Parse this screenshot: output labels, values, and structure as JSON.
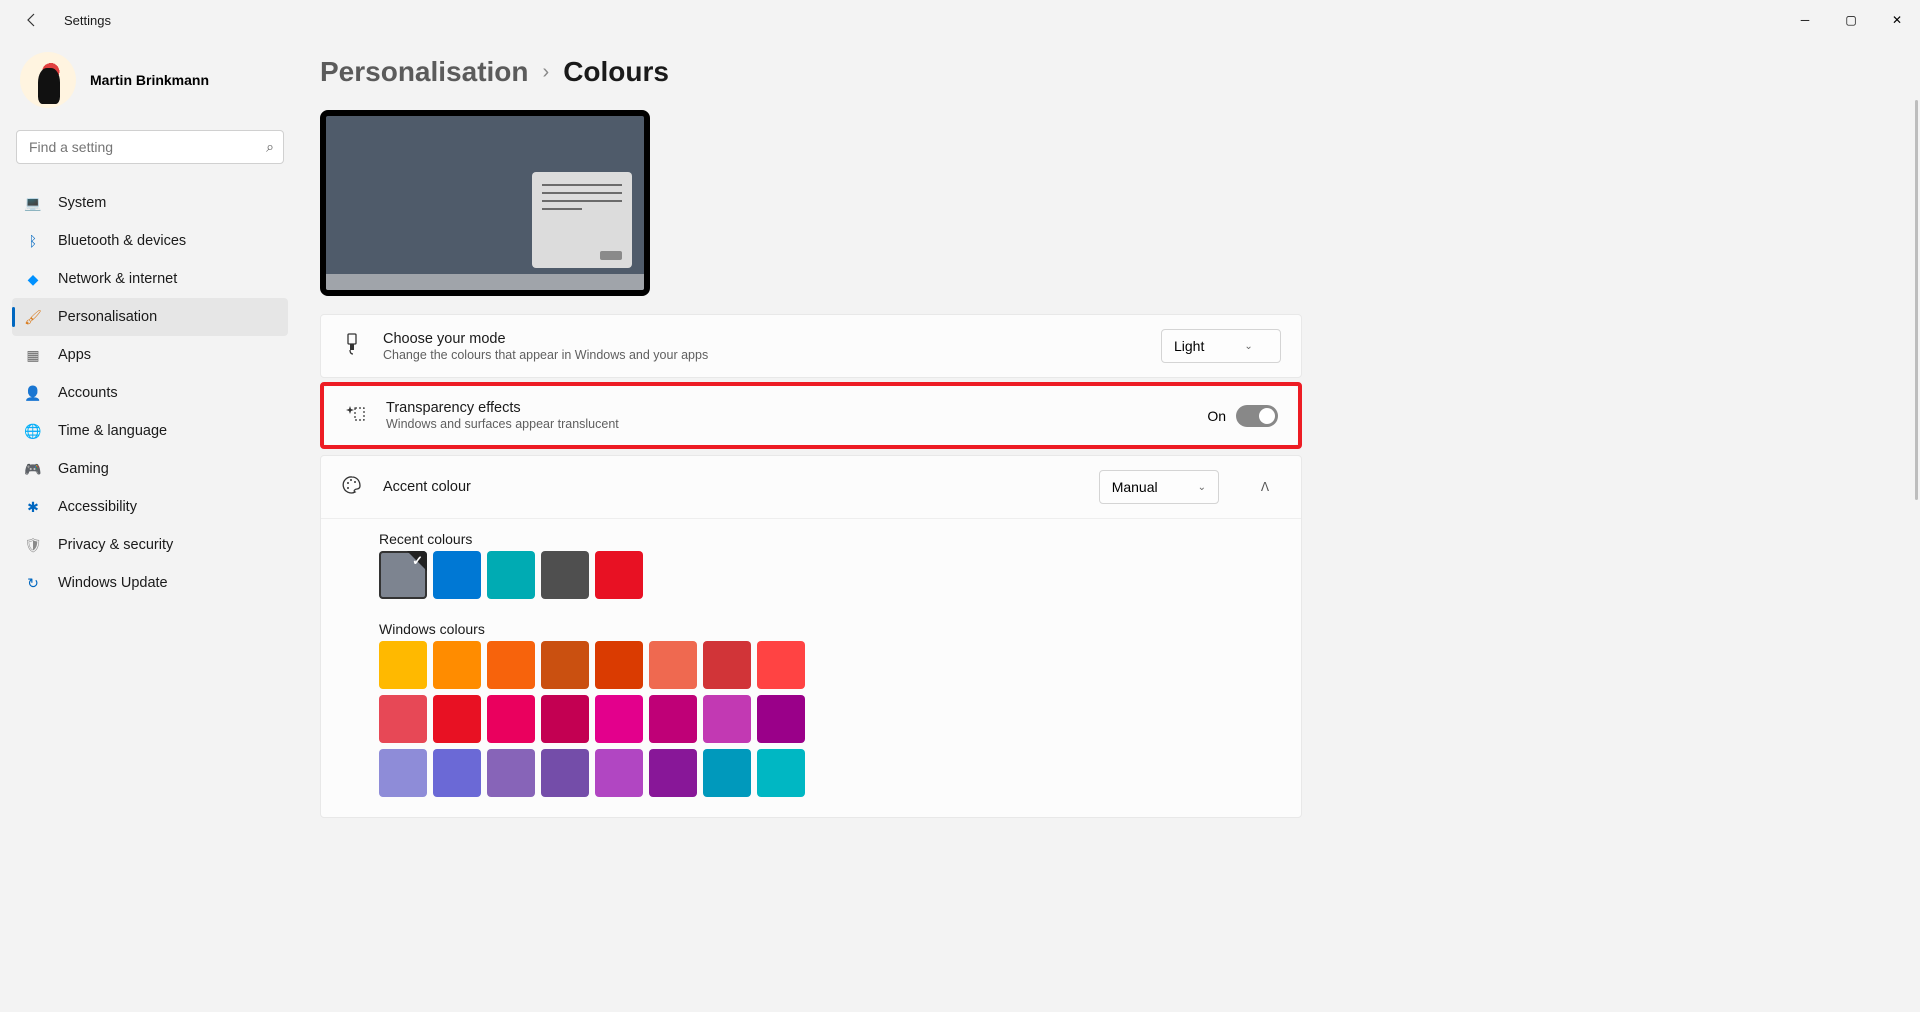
{
  "titlebar": {
    "title": "Settings"
  },
  "user": {
    "name": "Martin Brinkmann"
  },
  "search": {
    "placeholder": "Find a setting"
  },
  "nav": [
    {
      "label": "System",
      "icon": "💻",
      "color": "#0067c0"
    },
    {
      "label": "Bluetooth & devices",
      "icon": "ᛒ",
      "color": "#0067c0"
    },
    {
      "label": "Network & internet",
      "icon": "◆",
      "color": "#0091ff"
    },
    {
      "label": "Personalisation",
      "icon": "🖌",
      "color": "#d97a1b",
      "active": true
    },
    {
      "label": "Apps",
      "icon": "▦",
      "color": "#6a6a6a"
    },
    {
      "label": "Accounts",
      "icon": "👤",
      "color": "#0f8b4c"
    },
    {
      "label": "Time & language",
      "icon": "🌐",
      "color": "#5b7e9a"
    },
    {
      "label": "Gaming",
      "icon": "🎮",
      "color": "#8a8a8a"
    },
    {
      "label": "Accessibility",
      "icon": "✱",
      "color": "#0067c0"
    },
    {
      "label": "Privacy & security",
      "icon": "🛡",
      "color": "#8a8a8a"
    },
    {
      "label": "Windows Update",
      "icon": "↻",
      "color": "#0067c0"
    }
  ],
  "breadcrumb": {
    "parent": "Personalisation",
    "sep": "›",
    "current": "Colours"
  },
  "mode": {
    "title": "Choose your mode",
    "desc": "Change the colours that appear in Windows and your apps",
    "value": "Light"
  },
  "transparency": {
    "title": "Transparency effects",
    "desc": "Windows and surfaces appear translucent",
    "state_label": "On"
  },
  "accent": {
    "title": "Accent colour",
    "value": "Manual",
    "recent_label": "Recent colours",
    "recent": [
      "#7d8490",
      "#0078d4",
      "#00abb3",
      "#4f4f4f",
      "#e81123"
    ],
    "recent_selected": 0,
    "windows_label": "Windows colours",
    "windows": [
      "#ffb900",
      "#ff8c00",
      "#f7630c",
      "#ca5010",
      "#da3b01",
      "#ef6950",
      "#d13438",
      "#ff4343",
      "#e74856",
      "#e81123",
      "#ea005e",
      "#c30052",
      "#e3008c",
      "#bf0077",
      "#c239b3",
      "#9a0089",
      "#8e8cd8",
      "#6b69d6",
      "#8764b8",
      "#744da9",
      "#b146c2",
      "#881798",
      "#0099bc",
      "#00b7c3"
    ]
  }
}
